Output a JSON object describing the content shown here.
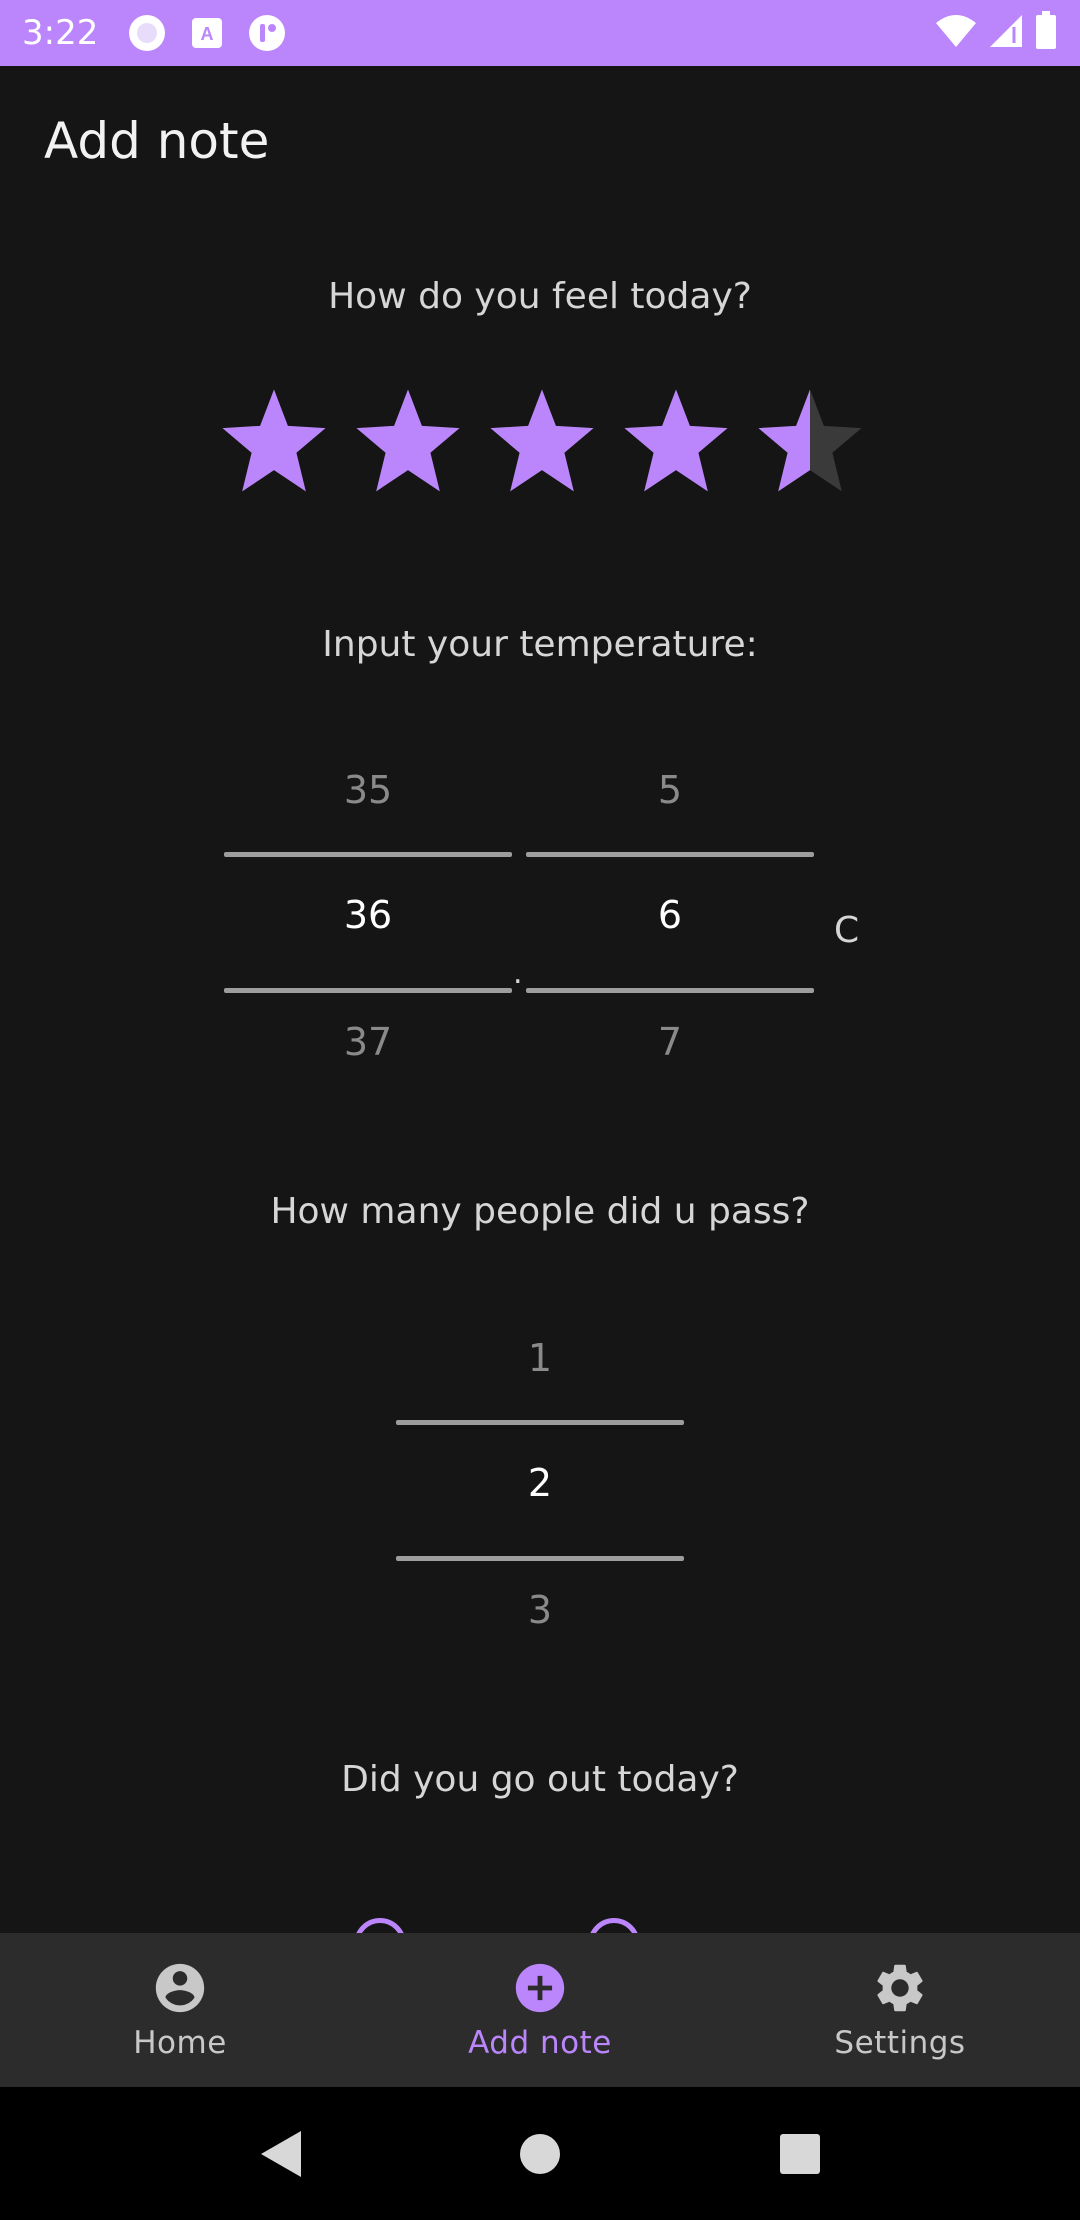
{
  "status_bar": {
    "time": "3:22",
    "icons_left": [
      "circle-notification-icon",
      "a-notification-icon",
      "app-notification-icon"
    ],
    "icons_right": [
      "wifi-icon",
      "signal-icon",
      "battery-icon"
    ]
  },
  "header": {
    "title": "Add note"
  },
  "mood": {
    "question": "How do you feel today?",
    "rating": 4.5,
    "max": 5,
    "filled_color": "#bb86fc",
    "empty_color": "#3a3a3a"
  },
  "temperature": {
    "question": "Input your temperature:",
    "integer_picker": {
      "prev": "35",
      "current": "36",
      "next": "37"
    },
    "separator": ".",
    "decimal_picker": {
      "prev": "5",
      "current": "6",
      "next": "7"
    },
    "unit": "C"
  },
  "people": {
    "question": "How many people did u pass?",
    "picker": {
      "prev": "1",
      "current": "2",
      "next": "3"
    }
  },
  "went_out": {
    "question": "Did you go out today?"
  },
  "bottom_nav": {
    "items": [
      {
        "label": "Home",
        "icon": "account-circle-icon",
        "active": false
      },
      {
        "label": "Add note",
        "icon": "add-circle-icon",
        "active": true
      },
      {
        "label": "Settings",
        "icon": "gear-icon",
        "active": false
      }
    ]
  },
  "colors": {
    "accent": "#bb86fc",
    "background": "#151515"
  }
}
